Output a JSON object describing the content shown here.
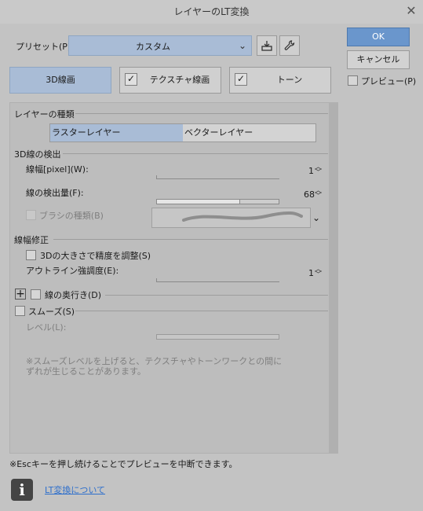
{
  "window": {
    "title": "レイヤーのLT変換",
    "close_icon": "close-icon"
  },
  "preset": {
    "label": "プリセット(P):",
    "value": "カスタム"
  },
  "buttons": {
    "ok": "OK",
    "cancel": "キャンセル",
    "preview": "プレビュー(P)"
  },
  "modes": [
    {
      "label": "3D線画",
      "selected": true
    },
    {
      "label": "テクスチャ線画",
      "checked": true
    },
    {
      "label": "トーン",
      "checked": true
    }
  ],
  "layer_type": {
    "heading": "レイヤーの種類",
    "options": [
      "ラスターレイヤー",
      "ベクターレイヤー"
    ],
    "selected": "ラスターレイヤー"
  },
  "detect": {
    "heading": "3D線の検出",
    "line_width_label": "線幅[pixel](W):",
    "line_width_value": "1",
    "amount_label": "線の検出量(F):",
    "amount_value": "68",
    "amount_fraction": 0.68,
    "brush_label": "ブラシの種類(B)"
  },
  "width_correct": {
    "heading": "線幅修正",
    "adjust_label": "3Dの大きさで精度を調整(S)",
    "outline_label": "アウトライン強調度(E):",
    "outline_value": "1"
  },
  "depth": {
    "label": "線の奥行き(D)"
  },
  "smooth": {
    "label": "スムーズ(S)",
    "level_label": "レベル(L):",
    "note_line1": "※スムーズレベルを上げると、テクスチャやトーンワークとの間に",
    "note_line2": "ずれが生じることがあります。"
  },
  "footer": {
    "hint": "※Escキーを押し続けることでプレビューを中断できます。",
    "link": "LT変換について"
  }
}
